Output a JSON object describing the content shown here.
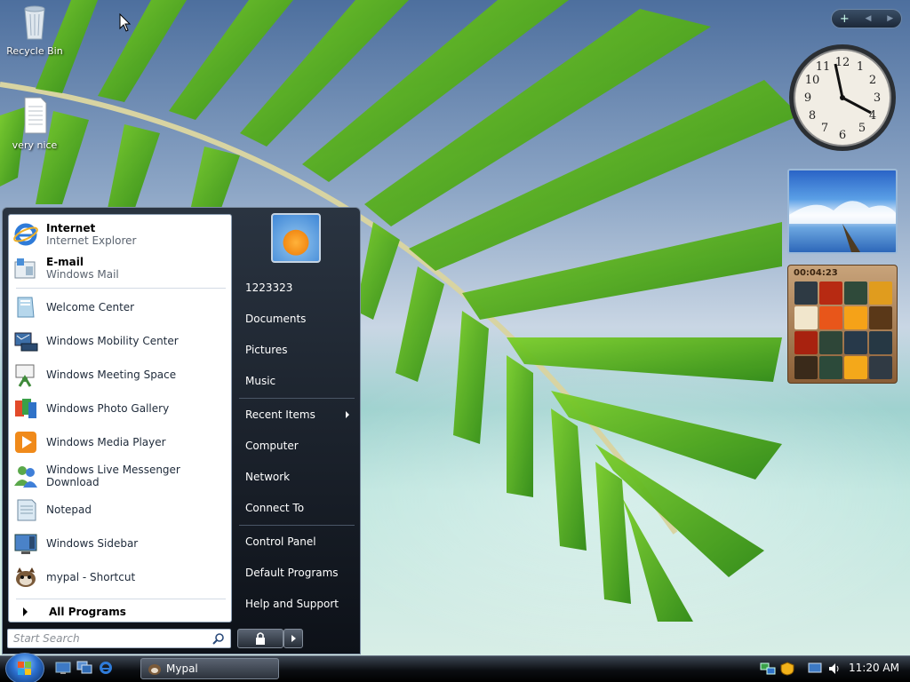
{
  "desktop": {
    "icons": [
      {
        "label": "Recycle Bin"
      },
      {
        "label": "very nice"
      }
    ]
  },
  "gadgets": {
    "puzzle_timer": "00:04:23"
  },
  "start_menu": {
    "pinned": [
      {
        "title": "Internet",
        "subtitle": "Internet Explorer"
      },
      {
        "title": "E-mail",
        "subtitle": "Windows Mail"
      }
    ],
    "recent": [
      {
        "label": "Welcome Center"
      },
      {
        "label": "Windows Mobility Center"
      },
      {
        "label": "Windows Meeting Space"
      },
      {
        "label": "Windows Photo Gallery"
      },
      {
        "label": "Windows Media Player"
      },
      {
        "label": "Windows Live Messenger Download"
      },
      {
        "label": "Notepad"
      },
      {
        "label": "Windows Sidebar"
      },
      {
        "label": "mypal - Shortcut"
      }
    ],
    "all_programs": "All Programs",
    "search_placeholder": "Start Search",
    "right": {
      "user": "1223323",
      "items": [
        "Documents",
        "Pictures",
        "Music",
        "Recent Items",
        "Computer",
        "Network",
        "Connect To",
        "Control Panel",
        "Default Programs",
        "Help and Support"
      ]
    }
  },
  "taskbar": {
    "task_label": "Mypal",
    "clock": "11:20 AM"
  }
}
